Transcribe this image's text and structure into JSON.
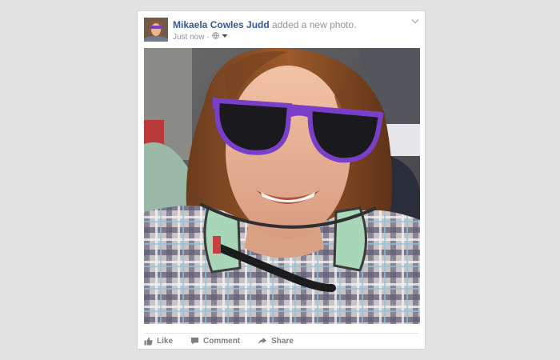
{
  "post": {
    "author": "Mikaela Cowles Judd",
    "action_text": "added a new photo.",
    "timestamp": "Just now",
    "separator": "·",
    "privacy_icon": "globe-icon",
    "dropdown_icon": "caret-down-icon",
    "menu_icon": "chevron-down-icon"
  },
  "actions": {
    "like": "Like",
    "comment": "Comment",
    "share": "Share"
  },
  "colors": {
    "author_link": "#365899",
    "muted_text": "#90949c",
    "action_text": "#7f7f7f",
    "background": "#e2e2e2"
  }
}
